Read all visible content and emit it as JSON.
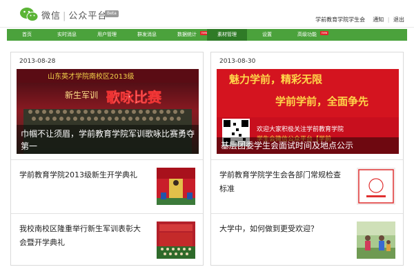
{
  "header": {
    "logo_wechat": "微信",
    "logo_platform": "公众平台",
    "beta": "Beta",
    "account_name": "学前教育学院学生会",
    "notify_label": "通知",
    "logout_label": "退出"
  },
  "nav": {
    "items": [
      {
        "label": "首页"
      },
      {
        "label": "实时消息"
      },
      {
        "label": "用户管理"
      },
      {
        "label": "群发消息"
      },
      {
        "label": "数据统计",
        "badge": "new"
      },
      {
        "label": "素材管理",
        "active": true
      },
      {
        "label": "设置"
      },
      {
        "label": "高级功能",
        "badge": "new"
      }
    ]
  },
  "cards": [
    {
      "date": "2013-08-28",
      "cover": {
        "caption": "巾帼不让须眉，学前教育学院军训歌咏比赛勇夺第一",
        "image_text_top": "山东英才学院南校区2013级",
        "image_text_side": "新生军训",
        "image_text_big": "歌咏比赛"
      },
      "items": [
        {
          "title": "学前教育学院2013级新生开学典礼"
        },
        {
          "title": "我校南校区隆重举行新生军训表彰大会暨开学典礼"
        }
      ]
    },
    {
      "date": "2013-08-30",
      "cover": {
        "caption": "基层团委学生会面试时间及地点公示",
        "image_text_line1": "魅力学前，精彩无限",
        "image_text_line2": "学前学前，全面争先",
        "image_text_welcome": "欢迎大家积极关注学前教育学院",
        "image_text_welcome2": "学生会微信公众平台【学前"
      },
      "items": [
        {
          "title": "学前教育学院学生会各部门常规检查标准"
        },
        {
          "title": "大学中，如何做到更受欢迎？"
        }
      ]
    }
  ],
  "colors": {
    "nav_green": "#4ba23c",
    "nav_active": "#2f7b27",
    "new_badge": "#e2262b",
    "wechat_green": "#5bb436"
  }
}
